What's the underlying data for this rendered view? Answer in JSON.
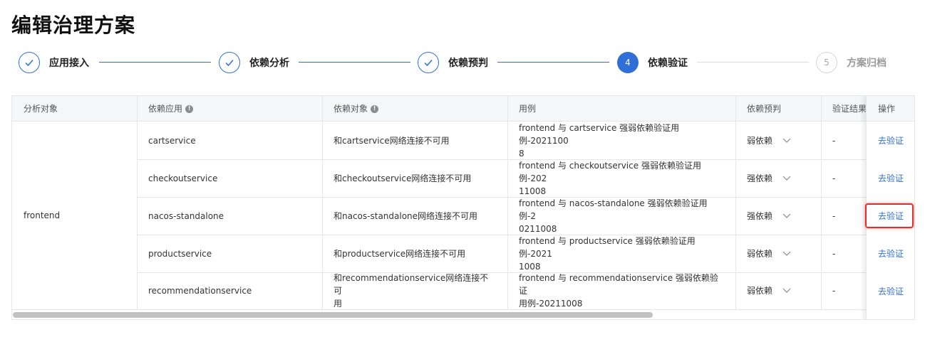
{
  "page": {
    "title": "编辑治理方案"
  },
  "steps": [
    {
      "index": "✓",
      "label": "应用接入",
      "state": "done"
    },
    {
      "index": "✓",
      "label": "依赖分析",
      "state": "done"
    },
    {
      "index": "✓",
      "label": "依赖预判",
      "state": "done"
    },
    {
      "index": "4",
      "label": "依赖验证",
      "state": "active"
    },
    {
      "index": "5",
      "label": "方案归档",
      "state": "pending"
    }
  ],
  "table": {
    "headers": {
      "analysis_target": "分析对象",
      "dependency_app": "依赖应用",
      "dependency_object": "依赖对象",
      "use_case": "用例",
      "dependency_prediction": "依赖预判",
      "verify_result": "验证结果",
      "operation": "操作"
    },
    "analysis_target": "frontend",
    "rows": [
      {
        "app": "cartservice",
        "object": "和cartservice网络连接不可用",
        "case_line1": "frontend 与 cartservice 强弱依赖验证用例-2021100",
        "case_line2": "8",
        "prediction": "弱依赖",
        "result": "-",
        "op": "去验证"
      },
      {
        "app": "checkoutservice",
        "object": "和checkoutservice网络连接不可用",
        "case_line1": "frontend 与 checkoutservice 强弱依赖验证用例-202",
        "case_line2": "11008",
        "prediction": "强依赖",
        "result": "-",
        "op": "去验证"
      },
      {
        "app": "nacos-standalone",
        "object": "和nacos-standalone网络连接不可用",
        "case_line1": "frontend 与 nacos-standalone 强弱依赖验证用例-2",
        "case_line2": "0211008",
        "prediction": "强依赖",
        "result": "-",
        "op": "去验证"
      },
      {
        "app": "productservice",
        "object": "和productservice网络连接不可用",
        "case_line1": "frontend 与 productservice 强弱依赖验证用例-2021",
        "case_line2": "1008",
        "prediction": "弱依赖",
        "result": "-",
        "op": "去验证"
      },
      {
        "app": "recommendationservice",
        "object_line1": "和recommendationservice网络连接不可",
        "object_line2": "用",
        "case_line1": "frontend 与 recommendationservice 强弱依赖验证",
        "case_line2": "用例-20211008",
        "prediction": "弱依赖",
        "result": "-",
        "op": "去验证"
      }
    ]
  },
  "icons": {
    "info": "info-icon",
    "chevron": "chevron-down-icon",
    "check": "check-icon"
  },
  "colors": {
    "accent": "#2f6fd6",
    "highlight": "#e0302c"
  }
}
